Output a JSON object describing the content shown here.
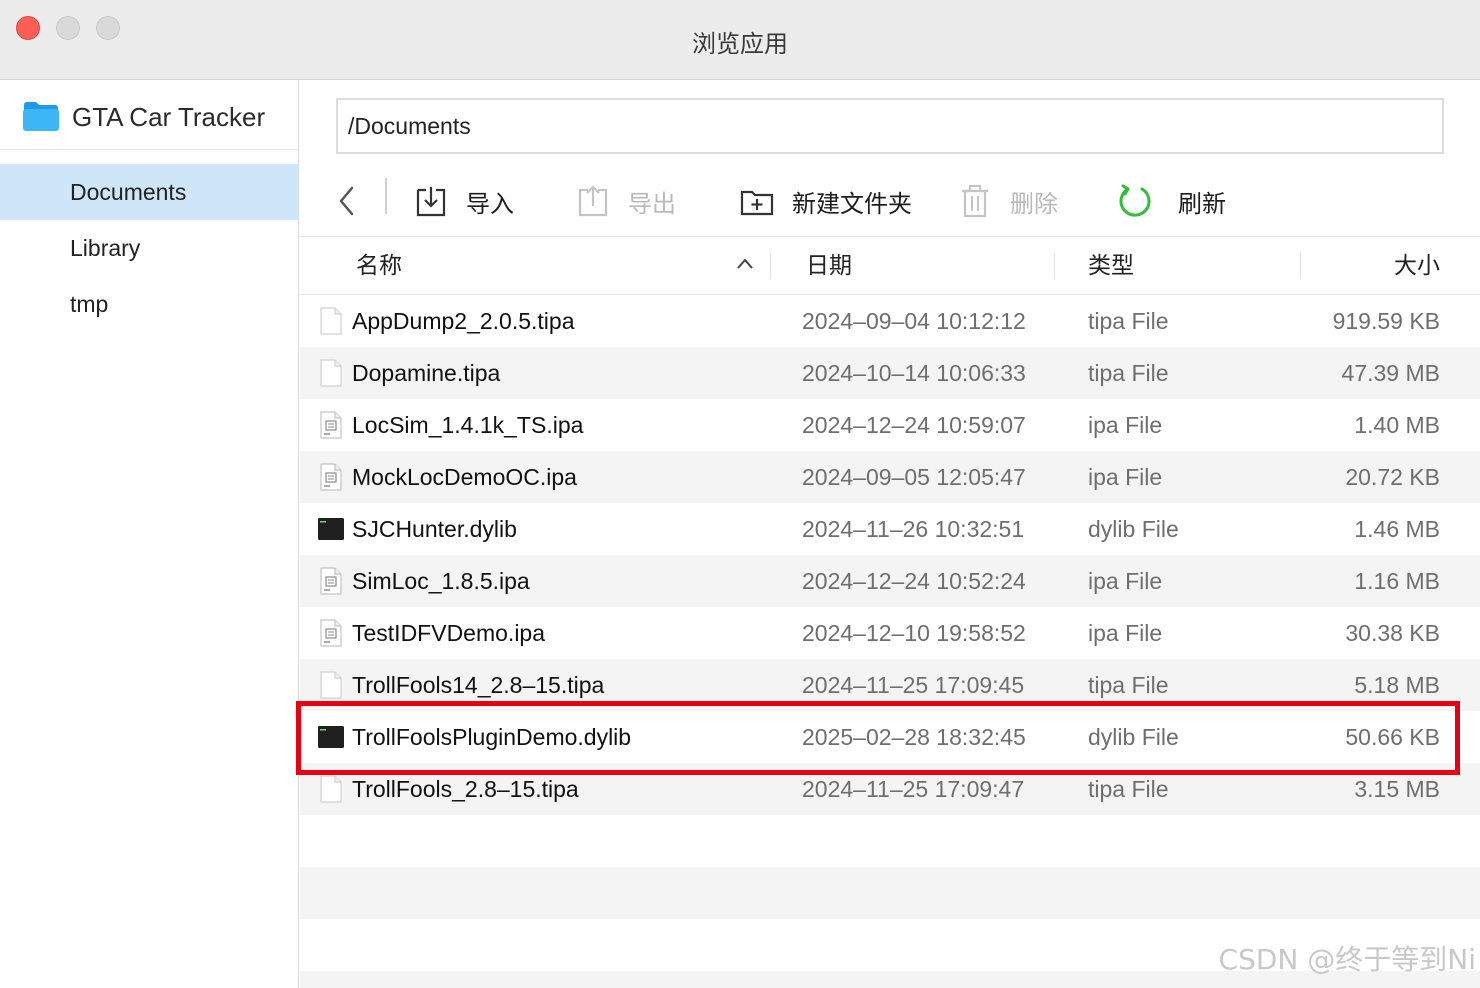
{
  "window": {
    "title": "浏览应用"
  },
  "sidebar": {
    "app_name": "GTA Car Tracker",
    "items": [
      {
        "label": "Documents",
        "selected": true
      },
      {
        "label": "Library",
        "selected": false
      },
      {
        "label": "tmp",
        "selected": false
      }
    ]
  },
  "path": {
    "value": "/Documents"
  },
  "toolbar": {
    "import_label": "导入",
    "export_label": "导出",
    "new_folder_label": "新建文件夹",
    "delete_label": "删除",
    "refresh_label": "刷新"
  },
  "table": {
    "columns": {
      "name": "名称",
      "date": "日期",
      "type": "类型",
      "size": "大小"
    },
    "sort_icon": "chevron-up-icon",
    "rows": [
      {
        "name": "AppDump2_2.0.5.tipa",
        "date": "2024–09–04 10:12:12",
        "type": "tipa File",
        "size": "919.59 KB",
        "icon": "document-icon"
      },
      {
        "name": "Dopamine.tipa",
        "date": "2024–10–14 10:06:33",
        "type": "tipa File",
        "size": "47.39 MB",
        "icon": "document-icon"
      },
      {
        "name": "LocSim_1.4.1k_TS.ipa",
        "date": "2024–12–24 10:59:07",
        "type": "ipa File",
        "size": "1.40 MB",
        "icon": "ipa-file-icon"
      },
      {
        "name": "MockLocDemoOC.ipa",
        "date": "2024–09–05 12:05:47",
        "type": "ipa File",
        "size": "20.72 KB",
        "icon": "ipa-file-icon"
      },
      {
        "name": "SJCHunter.dylib",
        "date": "2024–11–26 10:32:51",
        "type": "dylib File",
        "size": "1.46 MB",
        "icon": "terminal-icon"
      },
      {
        "name": "SimLoc_1.8.5.ipa",
        "date": "2024–12–24 10:52:24",
        "type": "ipa File",
        "size": "1.16 MB",
        "icon": "ipa-file-icon"
      },
      {
        "name": "TestIDFVDemo.ipa",
        "date": "2024–12–10 19:58:52",
        "type": "ipa File",
        "size": "30.38 KB",
        "icon": "ipa-file-icon"
      },
      {
        "name": "TrollFools14_2.8–15.tipa",
        "date": "2024–11–25 17:09:45",
        "type": "tipa File",
        "size": "5.18 MB",
        "icon": "document-icon"
      },
      {
        "name": "TrollFoolsPluginDemo.dylib",
        "date": "2025–02–28 18:32:45",
        "type": "dylib File",
        "size": "50.66 KB",
        "icon": "terminal-icon",
        "highlighted": true
      },
      {
        "name": "TrollFools_2.8–15.tipa",
        "date": "2024–11–25 17:09:47",
        "type": "tipa File",
        "size": "3.15 MB",
        "icon": "document-icon"
      }
    ]
  },
  "watermark": "CSDN @终于等到Ni",
  "colors": {
    "highlight": "#e60012",
    "selected_bg": "#cfe5f8",
    "refresh_green": "#2fbf3a",
    "close": "#ff5f57"
  }
}
